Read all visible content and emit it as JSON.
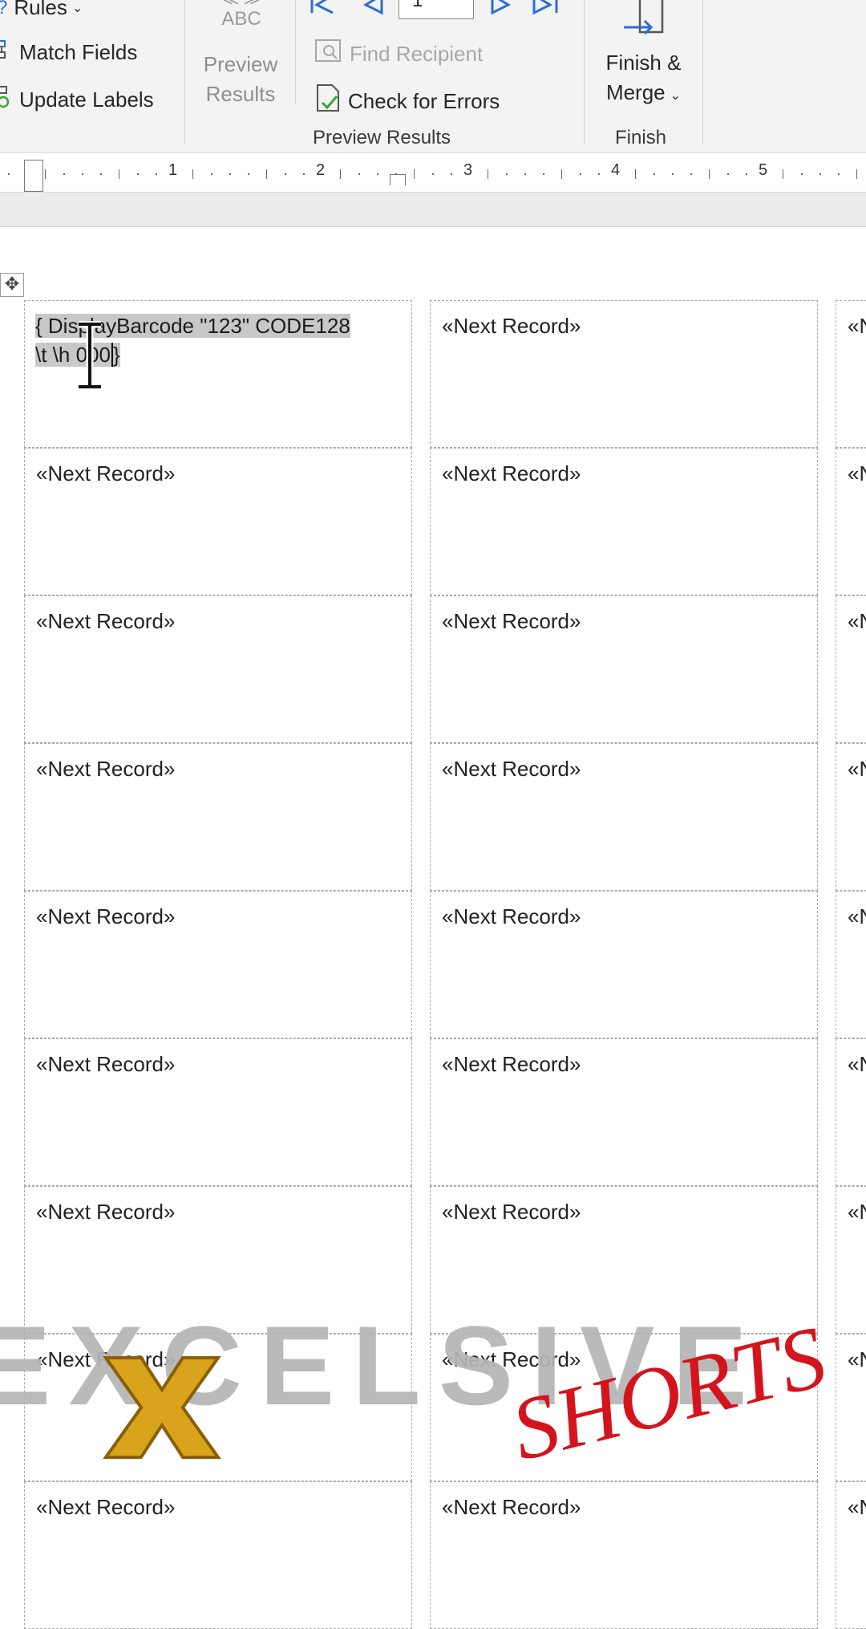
{
  "ribbon": {
    "rules_label": "Rules",
    "match_fields_label": "Match Fields",
    "update_labels_label": "Update Labels",
    "abc_label": "ABC",
    "preview_results_line1": "Preview",
    "preview_results_line2": "Results",
    "find_recipient_label": "Find Recipient",
    "check_errors_label": "Check for Errors",
    "preview_results_group": "Preview Results",
    "finish_merge_line1": "Finish &",
    "finish_merge_line2": "Merge",
    "finish_group": "Finish",
    "record_number": "1"
  },
  "ruler": {
    "numbers": [
      "1",
      "2",
      "3",
      "4",
      "5"
    ]
  },
  "document": {
    "field_code_line1": "{ DisplayBarcode \"123\" CODE128",
    "field_code_line2_a": "\\t \\h ",
    "field_code_line2_b": "000",
    "field_code_line2_c": "}",
    "next_record": "«Next Record»",
    "next_record_cut": "«N"
  },
  "watermark": {
    "brand": "EXCELSIVE",
    "tag": "SHORTS"
  },
  "colors": {
    "accent_blue": "#2b6fd6",
    "watermark_grey": "#b5b5b5",
    "watermark_red": "#d4141c",
    "gold": "#d9a31c"
  }
}
